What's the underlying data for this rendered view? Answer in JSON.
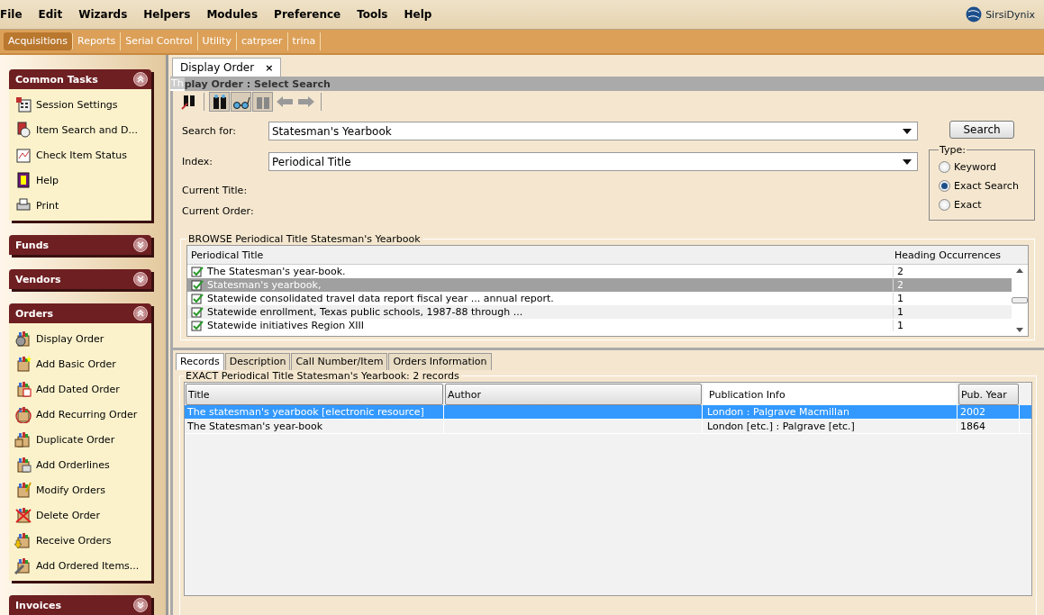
{
  "menu": [
    "File",
    "Edit",
    "Wizards",
    "Helpers",
    "Modules",
    "Preference",
    "Tools",
    "Help"
  ],
  "brand": "SirsiDynix",
  "modules": [
    {
      "label": "Acquisitions",
      "selected": true
    },
    {
      "label": "Reports",
      "selected": false
    },
    {
      "label": "Serial Control",
      "selected": false
    },
    {
      "label": "Utility",
      "selected": false
    },
    {
      "label": "catrpser",
      "selected": false
    },
    {
      "label": "trina",
      "selected": false
    }
  ],
  "sidebar": [
    {
      "title": "Common Tasks",
      "expanded": true,
      "items": [
        "Session Settings",
        "Item Search and D...",
        "Check Item Status",
        "Help",
        "Print"
      ]
    },
    {
      "title": "Funds",
      "expanded": false
    },
    {
      "title": "Vendors",
      "expanded": false
    },
    {
      "title": "Orders",
      "expanded": true,
      "items": [
        "Display Order",
        "Add Basic Order",
        "Add Dated Order",
        "Add Recurring Order",
        "Duplicate Order",
        "Add Orderlines",
        "Modify Orders",
        "Delete Order",
        "Receive Orders",
        "Add Ordered Items..."
      ]
    },
    {
      "title": "Invoices",
      "expanded": false
    }
  ],
  "doc_tab": {
    "label": "Display Order",
    "close": "×"
  },
  "title_bar": {
    "overlay": "Th",
    "title": "play Order : Select Search"
  },
  "form": {
    "search_label": "Search for:",
    "search_value": "Statesman's Yearbook",
    "index_label": "Index:",
    "index_value": "Periodical Title",
    "current_title_label": "Current Title:",
    "current_order_label": "Current Order:",
    "search_button": "Search"
  },
  "type_group": {
    "legend": "Type:",
    "options": [
      {
        "label": "Keyword",
        "selected": false
      },
      {
        "label": "Exact Search",
        "selected": true
      },
      {
        "label": "Exact",
        "selected": false
      }
    ]
  },
  "browse": {
    "legend": "BROWSE Periodical Title Statesman's Yearbook",
    "columns": [
      "Periodical Title",
      "Heading Occurrences"
    ],
    "rows": [
      {
        "title": "The Statesman's year-book.",
        "count": "2",
        "selected": false
      },
      {
        "title": "Statesman's yearbook,",
        "count": "2",
        "selected": true
      },
      {
        "title": "Statewide consolidated travel data report fiscal year ... annual report.",
        "count": "1",
        "selected": false
      },
      {
        "title": "Statewide enrollment, Texas public schools, 1987-88 through ...",
        "count": "1",
        "selected": false
      },
      {
        "title": "Statewide initiatives Region XIII",
        "count": "1",
        "selected": false
      }
    ]
  },
  "detail_tabs": [
    {
      "label": "Records",
      "selected": true
    },
    {
      "label": "Description",
      "selected": false
    },
    {
      "label": "Call Number/Item",
      "selected": false
    },
    {
      "label": "Orders Information",
      "selected": false
    }
  ],
  "records": {
    "legend": "EXACT Periodical Title Statesman's Yearbook: 2 records",
    "columns": [
      "Title",
      "Author",
      "Publication Info",
      "Pub. Year"
    ],
    "rows": [
      {
        "cells": [
          "The statesman's yearbook [electronic resource]",
          "",
          "London : Palgrave Macmillan",
          "2002"
        ],
        "selected": true
      },
      {
        "cells": [
          "The Statesman's year-book",
          "",
          "London [etc.] : Palgrave [etc.]",
          "1864"
        ],
        "selected": false
      }
    ]
  }
}
